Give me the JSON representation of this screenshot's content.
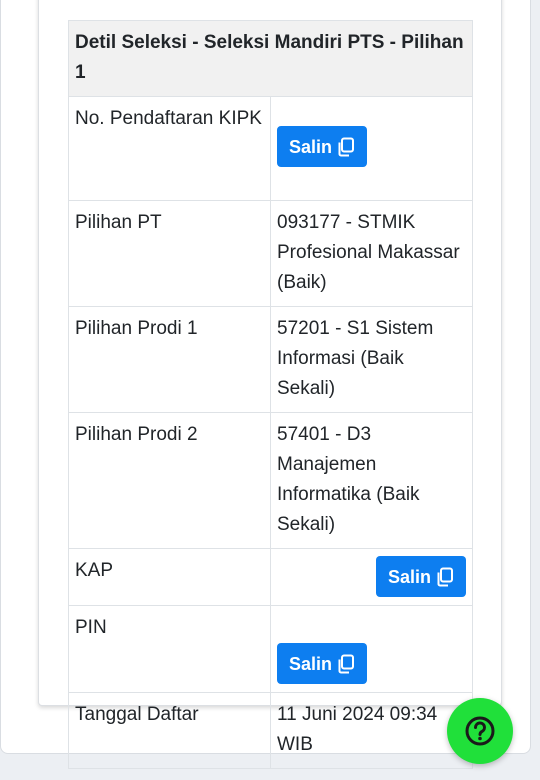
{
  "detail": {
    "title": "Detil Seleksi - Seleksi Mandiri PTS - Pilihan 1",
    "copy_label": "Salin",
    "rows": {
      "kipk": {
        "label": "No. Pendaftaran KIPK",
        "value": ""
      },
      "pt": {
        "label": "Pilihan PT",
        "value": "093177 - STMIK Profesional Makassar (Baik)"
      },
      "prodi1": {
        "label": "Pilihan Prodi 1",
        "value": "57201 - S1 Sistem Informasi (Baik Sekali)"
      },
      "prodi2": {
        "label": "Pilihan Prodi 2",
        "value": "57401 - D3 Manajemen Informatika (Baik Sekali)"
      },
      "kap": {
        "label": "KAP",
        "value": ""
      },
      "pin": {
        "label": "PIN",
        "value": ""
      },
      "tanggal": {
        "label": "Tanggal Daftar",
        "value": "11 Juni 2024 09:34 WIB"
      }
    }
  },
  "colors": {
    "button": "#0d7ef0",
    "help_fab": "#20e03a",
    "header_bg": "#f1f1f1"
  },
  "icons": {
    "copy": "copy-icon",
    "help": "question-circle-icon"
  }
}
